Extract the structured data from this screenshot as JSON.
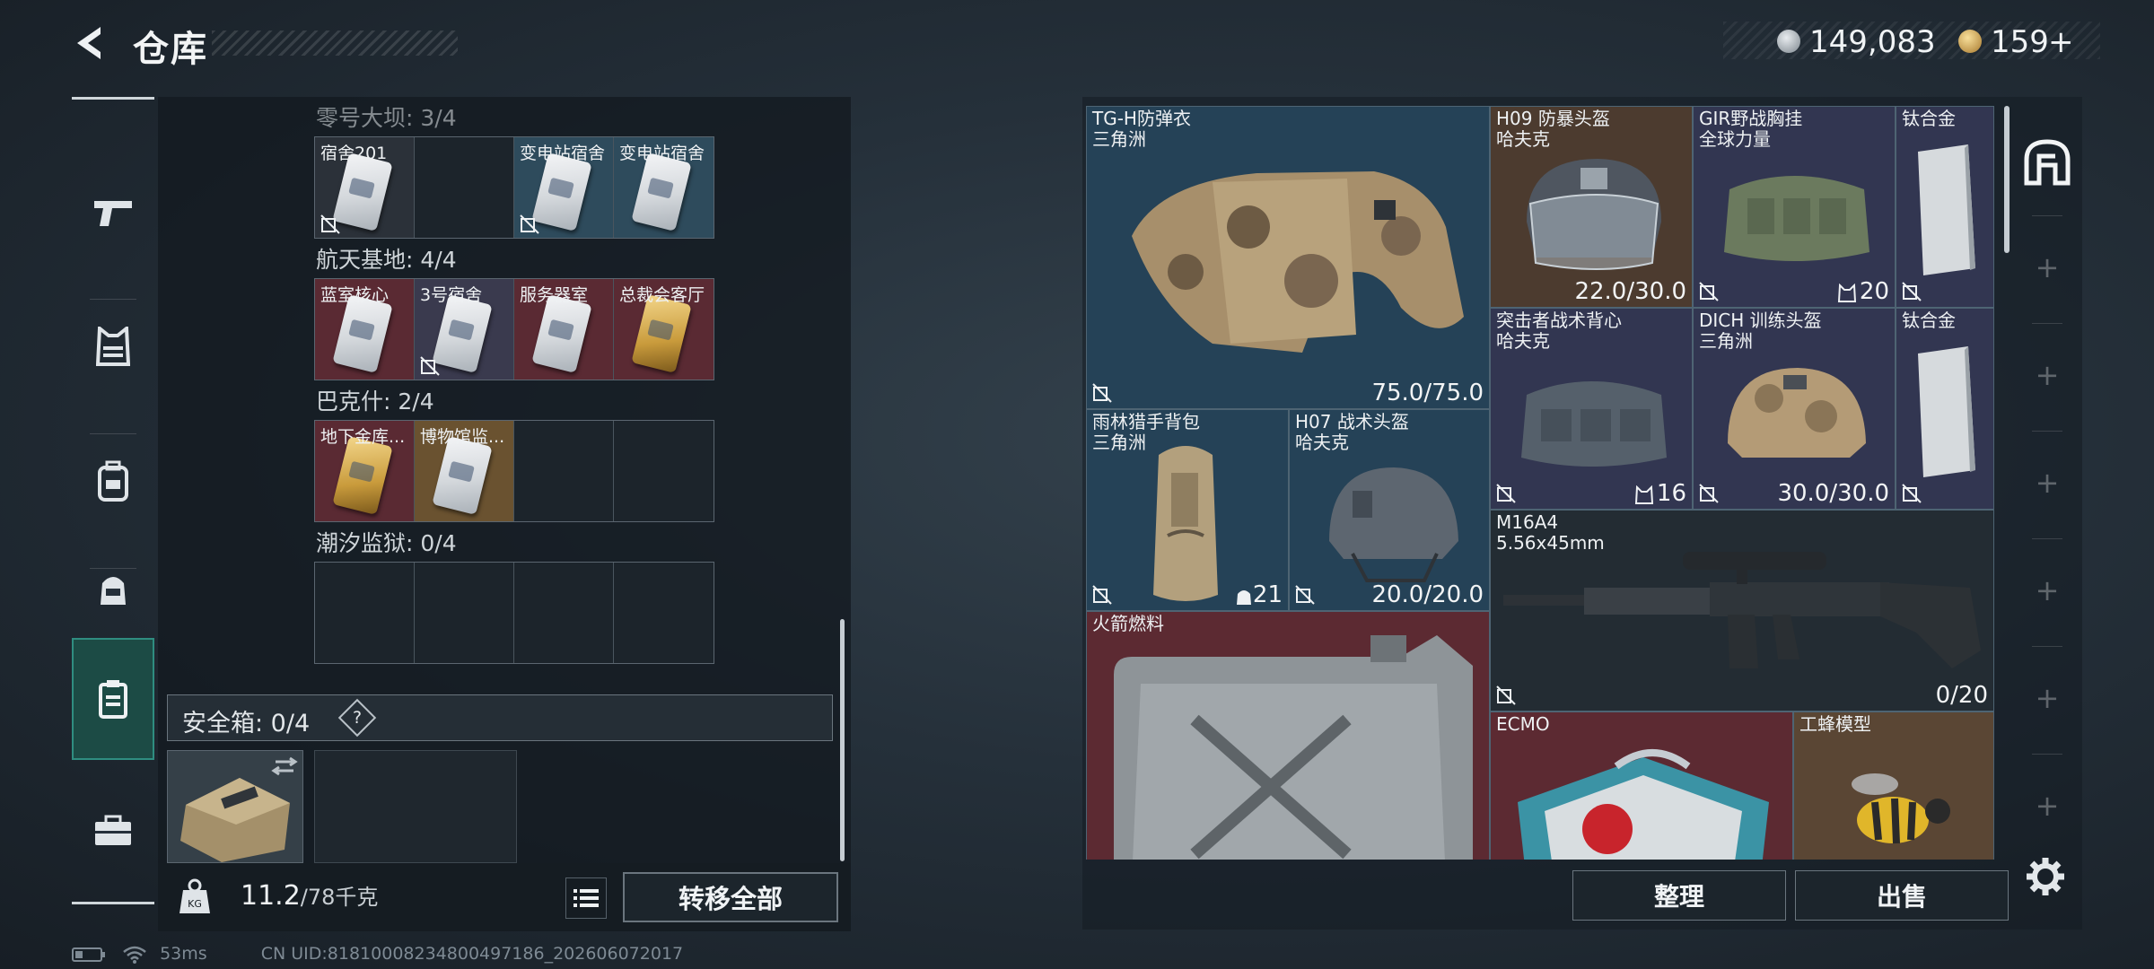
{
  "header": {
    "title": "仓库",
    "currency1_value": "149,083",
    "currency2_value": "159",
    "currency2_plus": "+"
  },
  "left_nav": {
    "items": [
      {
        "icon": "pistol-icon"
      },
      {
        "icon": "vest-icon"
      },
      {
        "icon": "backpack-icon"
      },
      {
        "icon": "bag-icon"
      },
      {
        "icon": "keycard-case-icon",
        "active": true
      },
      {
        "icon": "toolbox-icon"
      }
    ]
  },
  "key_sections": [
    {
      "title": "零号大坝: 3/4",
      "cards": [
        {
          "label": "宿舍201",
          "color": "dark",
          "locked": true
        },
        {
          "label": "",
          "color": "empty",
          "locked": false
        },
        {
          "label": "变电站宿舍",
          "color": "blue",
          "locked": true
        },
        {
          "label": "变电站宿舍",
          "color": "blue",
          "locked": false
        }
      ]
    },
    {
      "title": "航天基地: 4/4",
      "cards": [
        {
          "label": "蓝室核心",
          "color": "red",
          "locked": false
        },
        {
          "label": "3号宿舍",
          "color": "purple",
          "locked": true
        },
        {
          "label": "服务器室",
          "color": "red",
          "locked": false
        },
        {
          "label": "总裁会客厅",
          "color": "red",
          "locked": false,
          "gold": true
        }
      ]
    },
    {
      "title": "巴克什: 2/4",
      "cards": [
        {
          "label": "地下金库...",
          "color": "red",
          "locked": false,
          "gold": true
        },
        {
          "label": "博物馆监...",
          "color": "gold",
          "locked": false
        },
        {
          "label": "",
          "color": "empty",
          "locked": false
        },
        {
          "label": "",
          "color": "empty",
          "locked": false
        }
      ]
    },
    {
      "title": "潮汐监狱: 0/4",
      "cards": [
        {
          "label": "",
          "color": "empty",
          "locked": false
        },
        {
          "label": "",
          "color": "empty",
          "locked": false
        },
        {
          "label": "",
          "color": "empty",
          "locked": false
        },
        {
          "label": "",
          "color": "empty",
          "locked": false
        }
      ]
    }
  ],
  "safebox": {
    "label": "安全箱: 0/4",
    "help": "?"
  },
  "left_bottom": {
    "weight_value": "11.2",
    "weight_max": "/78千克",
    "transfer_all": "转移全部"
  },
  "status_bar": {
    "ping": "53ms",
    "uid": "CN UID:81810008234800497186_202606072017"
  },
  "items": [
    {
      "name": "TG-H防弹衣\n三角洲",
      "value": "75.0/75.0",
      "color": "blue",
      "art": "armor"
    },
    {
      "name": "H09 防暴头盔\n哈夫克",
      "value": "22.0/30.0",
      "color": "brown",
      "art": "helmet-visor"
    },
    {
      "name": "GIR野战胸挂\n全球力量",
      "value": "20",
      "color": "purple",
      "art": "chest-rig",
      "capacity": true
    },
    {
      "name": "钛合金",
      "value": "",
      "color": "purple",
      "art": "plate"
    },
    {
      "name": "突击者战术背心\n哈夫克",
      "value": "16",
      "color": "purple",
      "art": "tactical-vest",
      "capacity": true
    },
    {
      "name": "DICH 训练头盔\n三角洲",
      "value": "30.0/30.0",
      "color": "purple",
      "art": "helmet-camo"
    },
    {
      "name": "钛合金",
      "value": "",
      "color": "purple",
      "art": "plate"
    },
    {
      "name": "雨林猎手背包\n三角洲",
      "value": "21",
      "color": "blue",
      "art": "backpack",
      "capacity": true
    },
    {
      "name": "H07 战术头盔\n哈夫克",
      "value": "20.0/20.0",
      "color": "blue",
      "art": "helmet"
    },
    {
      "name": "M16A4\n5.56x45mm",
      "value": "0/20",
      "color": "dark",
      "art": "rifle"
    },
    {
      "name": "火箭燃料",
      "value": "",
      "color": "red",
      "art": "jerrycan"
    },
    {
      "name": "ECMO",
      "value": "",
      "color": "red",
      "art": "ecmo"
    },
    {
      "name": "工蜂模型",
      "value": "",
      "color": "gold",
      "art": "bee"
    }
  ],
  "actions": {
    "sort": "整理",
    "sell": "出售"
  },
  "colors": {
    "accent_teal": "#2f8d80",
    "rarity_blue": "#254257",
    "rarity_purple": "#323651",
    "rarity_red": "#5c2a32",
    "rarity_gold": "#5a4634"
  }
}
